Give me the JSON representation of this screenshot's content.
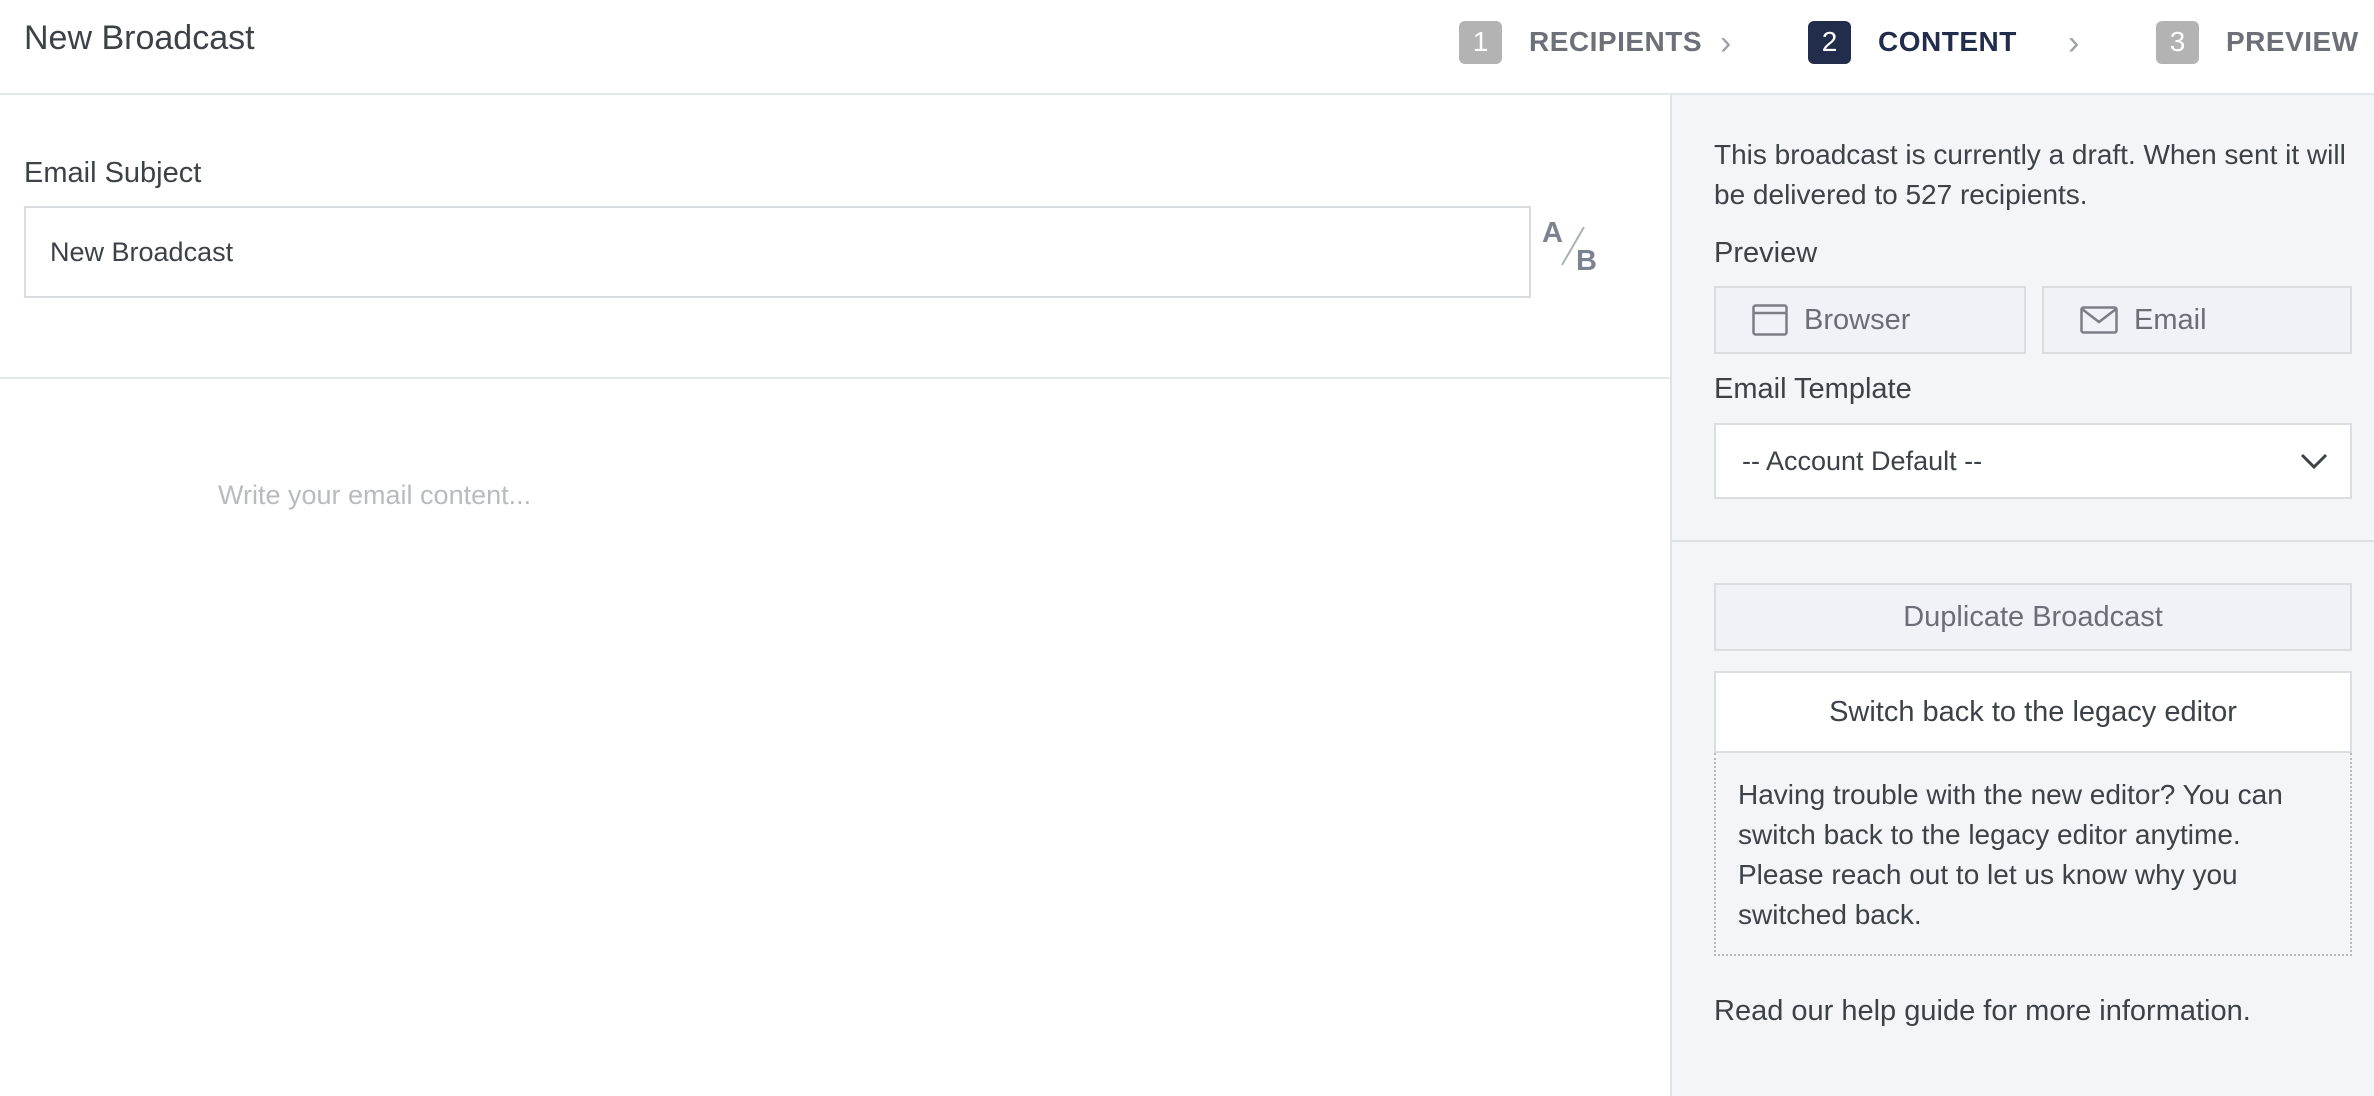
{
  "header": {
    "title": "New Broadcast",
    "steps": [
      {
        "number": "1",
        "label": "RECIPIENTS",
        "active": false
      },
      {
        "number": "2",
        "label": "CONTENT",
        "active": true
      },
      {
        "number": "3",
        "label": "PREVIEW",
        "active": false
      }
    ],
    "arrow_glyph": "›"
  },
  "subject": {
    "label": "Email Subject",
    "value": "New Broadcast",
    "ab_toggle": {
      "a": "A",
      "b": "B",
      "icon": "ab-split-icon"
    }
  },
  "editor": {
    "placeholder": "Write your email content..."
  },
  "sidebar": {
    "draft_notice": "This broadcast is currently a draft. When sent it will be delivered to 527 recipients.",
    "preview_label": "Preview",
    "preview_browser": {
      "label": "Browser",
      "icon": "browser-window-icon"
    },
    "preview_email": {
      "label": "Email",
      "icon": "envelope-icon"
    },
    "template_label": "Email Template",
    "template_selected": "-- Account Default --",
    "duplicate_label": "Duplicate Broadcast",
    "legacy_button_label": "Switch back to the legacy editor",
    "legacy_help_text": "Having trouble with the new editor? You can switch back to the legacy editor anytime. Please reach out to let us know why you switched back.",
    "help_guide_text": "Read our help guide for more information."
  },
  "colors": {
    "accent": "#222d4c",
    "step_inactive": "#b3b3b3",
    "sidebar_bg": "#f3f5f8",
    "placeholder": "#b8bbbf"
  }
}
